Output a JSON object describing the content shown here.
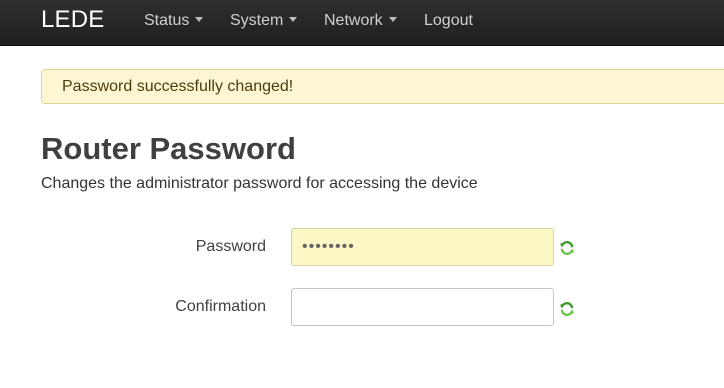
{
  "navbar": {
    "brand": "LEDE",
    "items": [
      {
        "label": "Status",
        "has_dropdown": true
      },
      {
        "label": "System",
        "has_dropdown": true
      },
      {
        "label": "Network",
        "has_dropdown": true
      },
      {
        "label": "Logout",
        "has_dropdown": false
      }
    ],
    "background": "#242424",
    "text_color": "#d0d0d0"
  },
  "alert": {
    "message": "Password successfully changed!",
    "background": "#fcf7d2"
  },
  "page": {
    "title": "Router Password",
    "description": "Changes the administrator password for accessing the device"
  },
  "form": {
    "password": {
      "label": "Password",
      "value": "••••••••",
      "icon": "reload-icon"
    },
    "confirmation": {
      "label": "Confirmation",
      "value": "",
      "icon": "reload-icon"
    }
  }
}
